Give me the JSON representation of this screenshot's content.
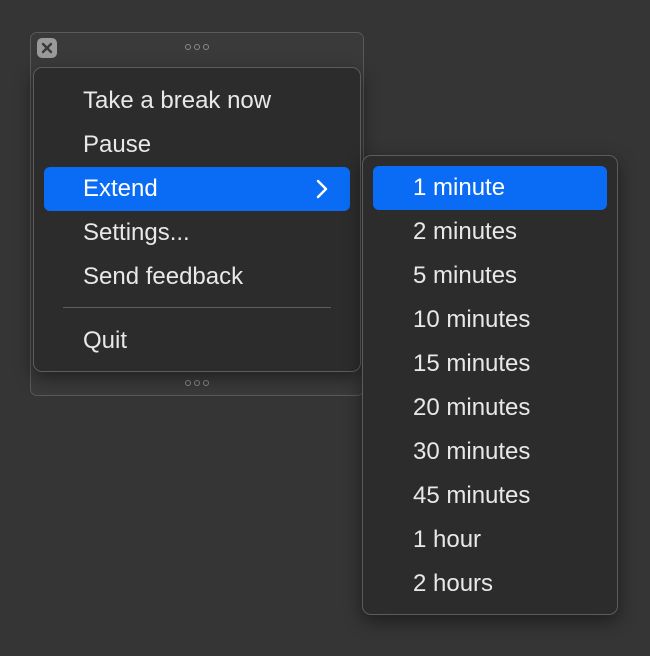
{
  "host_window": {
    "close_icon": "x-icon",
    "grip_icon": "three-dots-grip-icon"
  },
  "menu": {
    "items": [
      {
        "label": "Take a break now"
      },
      {
        "label": "Pause"
      },
      {
        "label": "Extend",
        "has_submenu": true,
        "selected": true
      },
      {
        "label": "Settings..."
      },
      {
        "label": "Send feedback"
      }
    ],
    "quit_label": "Quit"
  },
  "submenu": {
    "items": [
      {
        "label": "1 minute",
        "selected": true
      },
      {
        "label": "2 minutes"
      },
      {
        "label": "5 minutes"
      },
      {
        "label": "10 minutes"
      },
      {
        "label": "15 minutes"
      },
      {
        "label": "20 minutes"
      },
      {
        "label": "30 minutes"
      },
      {
        "label": "45 minutes"
      },
      {
        "label": "1 hour"
      },
      {
        "label": "2 hours"
      }
    ]
  },
  "colors": {
    "background": "#353535",
    "menu_background": "#2c2c2c",
    "highlight": "#0a6cf5",
    "text": "#e8e8e8"
  }
}
